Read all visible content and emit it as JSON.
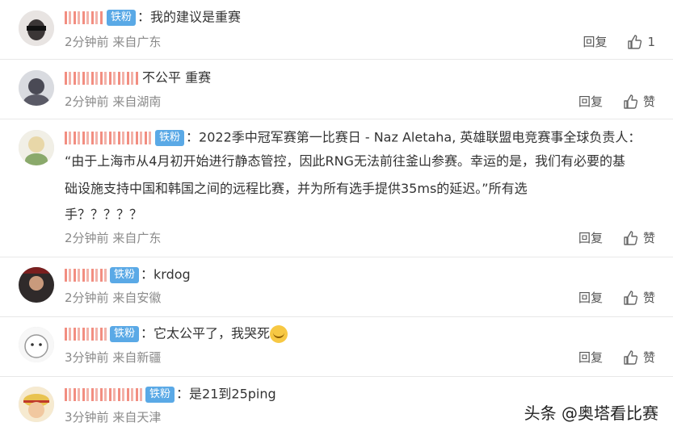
{
  "badge_label": "铁粉",
  "reply_label": "回复",
  "comments": [
    {
      "text": "我的建议是重赛",
      "time": "2分钟前",
      "location": "来自广东",
      "like_label": "1"
    },
    {
      "text": "不公平 重赛",
      "time": "2分钟前",
      "location": "来自湖南",
      "like_label": "赞"
    },
    {
      "text": "2022季中冠军赛第一比赛日 - Naz Aletaha, 英雄联盟电竞赛事全球负责人：",
      "body": [
        "“由于上海市从4月初开始进行静态管控，因此RNG无法前往釜山参赛。幸运的是，我们有必要的基",
        "础设施支持中国和韩国之间的远程比赛，并为所有选手提供35ms的延迟。”所有选",
        "手？？？？？"
      ],
      "time": "2分钟前",
      "location": "来自广东",
      "like_label": "赞"
    },
    {
      "text": "krdog",
      "time": "2分钟前",
      "location": "来自安徽",
      "like_label": "赞"
    },
    {
      "text": "它太公平了，我哭死",
      "time": "3分钟前",
      "location": "来自新疆",
      "like_label": "赞"
    },
    {
      "text": "是21到25ping",
      "time": "3分钟前",
      "location": "来自天津",
      "like_label": ""
    }
  ],
  "watermark": "头条 @奥塔看比赛"
}
